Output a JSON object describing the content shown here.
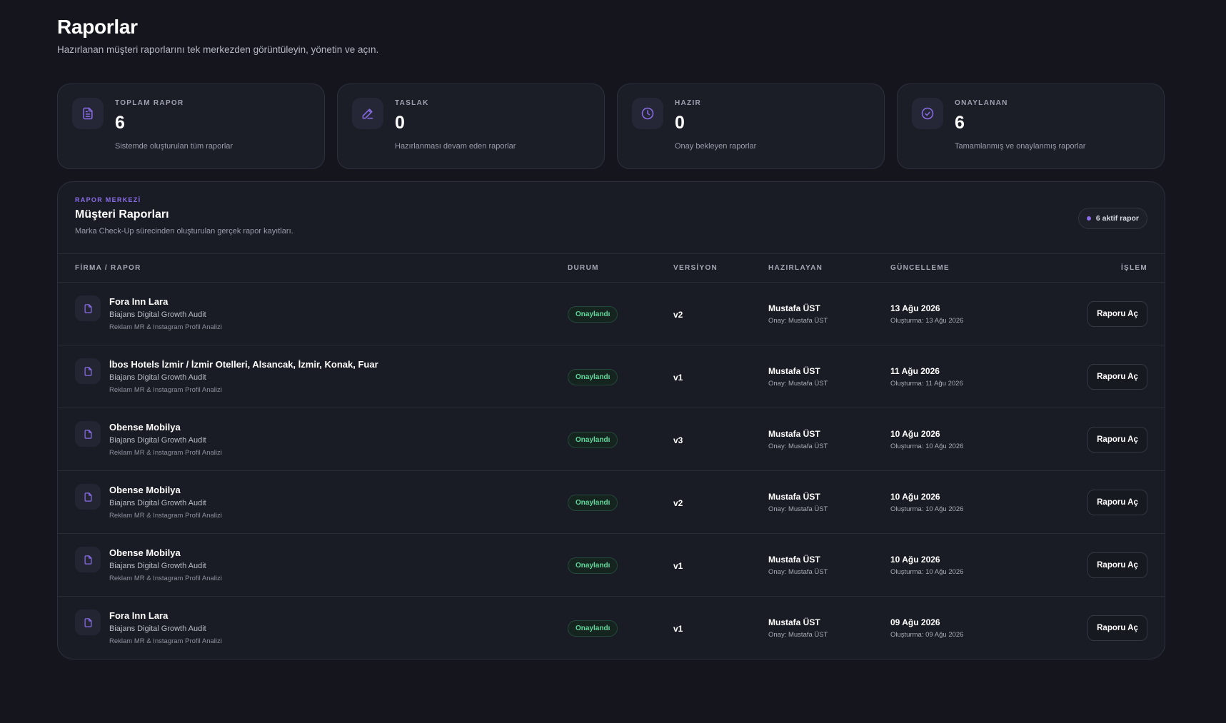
{
  "header": {
    "title": "Raporlar",
    "subtitle": "Hazırlanan müşteri raporlarını tek merkezden görüntüleyin, yönetin ve açın."
  },
  "stats": [
    {
      "icon": "document-icon",
      "label": "TOPLAM RAPOR",
      "value": "6",
      "desc": "Sistemde oluşturulan tüm raporlar"
    },
    {
      "icon": "pencil-icon",
      "label": "TASLAK",
      "value": "0",
      "desc": "Hazırlanması devam eden raporlar"
    },
    {
      "icon": "clock-icon",
      "label": "HAZIR",
      "value": "0",
      "desc": "Onay bekleyen raporlar"
    },
    {
      "icon": "check-circle-icon",
      "label": "ONAYLANAN",
      "value": "6",
      "desc": "Tamamlanmış ve onaylanmış raporlar"
    }
  ],
  "panel": {
    "eyebrow": "RAPOR MERKEZİ",
    "title": "Müşteri Raporları",
    "desc": "Marka Check-Up sürecinden oluşturulan gerçek rapor kayıtları.",
    "active_badge": "6 aktif rapor"
  },
  "table": {
    "columns": {
      "firm": "FİRMA / RAPOR",
      "status": "DURUM",
      "version": "VERSİYON",
      "preparer": "HAZIRLAYAN",
      "updated": "GÜNCELLEME",
      "action": "İŞLEM"
    },
    "rows": [
      {
        "firm": "Fora Inn Lara",
        "type": "Biajans Digital Growth Audit",
        "sub": "Reklam MR & Instagram Profil Analizi",
        "status": "Onaylandı",
        "version": "v2",
        "preparer": "Mustafa ÜST",
        "approval": "Onay: Mustafa ÜST",
        "updated": "13 Ağu 2026",
        "created": "Oluşturma: 13 Ağu 2026",
        "action": "Raporu Aç"
      },
      {
        "firm": "İbos Hotels İzmir / İzmir Otelleri, Alsancak, İzmir, Konak, Fuar",
        "type": "Biajans Digital Growth Audit",
        "sub": "Reklam MR & Instagram Profil Analizi",
        "status": "Onaylandı",
        "version": "v1",
        "preparer": "Mustafa ÜST",
        "approval": "Onay: Mustafa ÜST",
        "updated": "11 Ağu 2026",
        "created": "Oluşturma: 11 Ağu 2026",
        "action": "Raporu Aç"
      },
      {
        "firm": "Obense Mobilya",
        "type": "Biajans Digital Growth Audit",
        "sub": "Reklam MR & Instagram Profil Analizi",
        "status": "Onaylandı",
        "version": "v3",
        "preparer": "Mustafa ÜST",
        "approval": "Onay: Mustafa ÜST",
        "updated": "10 Ağu 2026",
        "created": "Oluşturma: 10 Ağu 2026",
        "action": "Raporu Aç"
      },
      {
        "firm": "Obense Mobilya",
        "type": "Biajans Digital Growth Audit",
        "sub": "Reklam MR & Instagram Profil Analizi",
        "status": "Onaylandı",
        "version": "v2",
        "preparer": "Mustafa ÜST",
        "approval": "Onay: Mustafa ÜST",
        "updated": "10 Ağu 2026",
        "created": "Oluşturma: 10 Ağu 2026",
        "action": "Raporu Aç"
      },
      {
        "firm": "Obense Mobilya",
        "type": "Biajans Digital Growth Audit",
        "sub": "Reklam MR & Instagram Profil Analizi",
        "status": "Onaylandı",
        "version": "v1",
        "preparer": "Mustafa ÜST",
        "approval": "Onay: Mustafa ÜST",
        "updated": "10 Ağu 2026",
        "created": "Oluşturma: 10 Ağu 2026",
        "action": "Raporu Aç"
      },
      {
        "firm": "Fora Inn Lara",
        "type": "Biajans Digital Growth Audit",
        "sub": "Reklam MR & Instagram Profil Analizi",
        "status": "Onaylandı",
        "version": "v1",
        "preparer": "Mustafa ÜST",
        "approval": "Onay: Mustafa ÜST",
        "updated": "09 Ağu 2026",
        "created": "Oluşturma: 09 Ağu 2026",
        "action": "Raporu Aç"
      }
    ]
  },
  "colors": {
    "background": "#14151d",
    "card": "#1b1d27",
    "accent": "#8b6de8",
    "success": "#5fd89a"
  }
}
